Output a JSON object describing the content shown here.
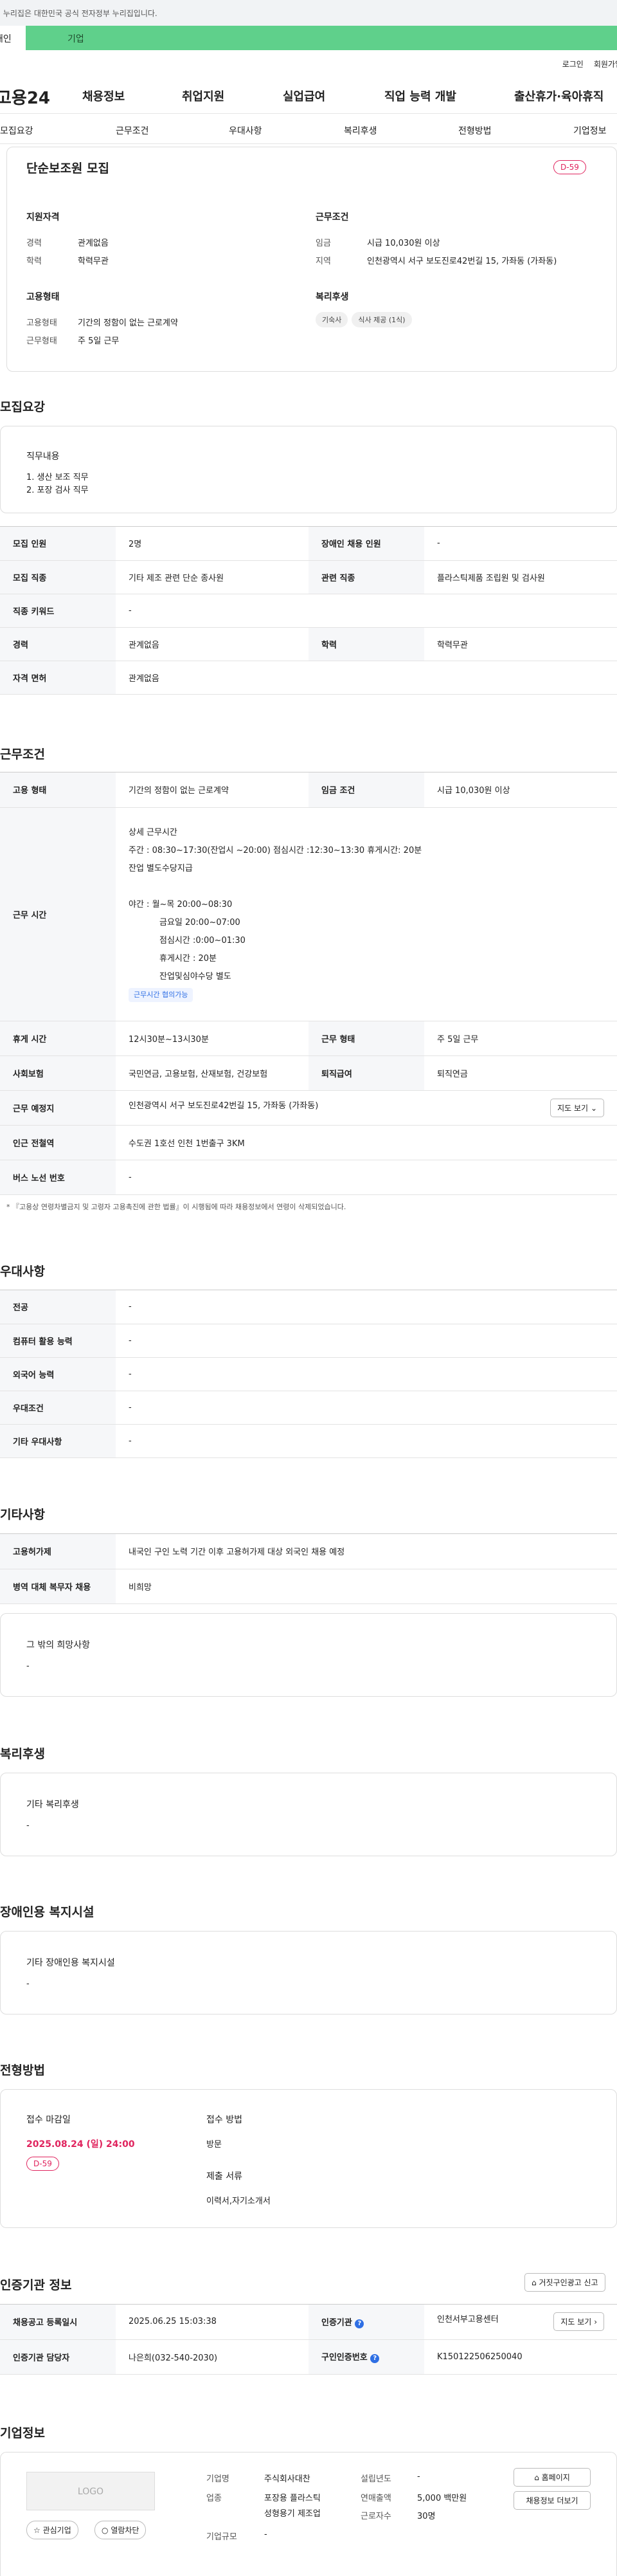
{
  "gov_banner": "이 누리집은 대한민국 공식 전자정부 누리집입니다.",
  "tabs": {
    "personal": "개인",
    "enterprise": "기업"
  },
  "util": {
    "login": "로그인",
    "signup": "회원가입"
  },
  "gnb": {
    "logo": "고용24",
    "menus": [
      "채용정보",
      "취업지원",
      "실업급여",
      "직업 능력 개발",
      "출산휴가·육아휴직"
    ]
  },
  "subnav": [
    "모집요강",
    "근무조건",
    "우대사항",
    "복리후생",
    "전형방법",
    "기업정보"
  ],
  "summary": {
    "title": "단순보조원 모집",
    "dday": "D-59",
    "qual_title": "지원자격",
    "qual": [
      {
        "k": "경력",
        "v": "관계없음"
      },
      {
        "k": "학력",
        "v": "학력무관"
      }
    ],
    "work_title": "근무조건",
    "work": [
      {
        "k": "임금",
        "v": "시급 10,030원 이상"
      },
      {
        "k": "지역",
        "v": "인천광역시 서구 보도진로42번길 15, 가좌동 (가좌동)"
      }
    ],
    "emp_title": "고용형태",
    "emp": [
      {
        "k": "고용형태",
        "v": "기간의 정함이 없는 근로계약"
      },
      {
        "k": "근무형태",
        "v": "주 5일 근무"
      }
    ],
    "welfare_title": "복리후생",
    "welfare_chips": [
      "기숙사",
      "식사 제공 (1식)"
    ]
  },
  "recruit": {
    "heading": "모집요강",
    "duty_title": "직무내용",
    "duties": [
      "1. 생산 보조 직무",
      "2. 포장 검사 직무"
    ],
    "rows": [
      {
        "k": "모집 인원",
        "v": "2명",
        "k2": "장애인 채용 인원",
        "v2": "-"
      },
      {
        "k": "모집 직종",
        "v": "기타 제조 관련 단순 종사원",
        "k2": "관련 직종",
        "v2": "플라스틱제품 조립원 및 검사원"
      },
      {
        "k": "직종 키워드",
        "v": "-"
      },
      {
        "k": "경력",
        "v": "관계없음",
        "k2": "학력",
        "v2": "학력무관"
      },
      {
        "k": "자격 면허",
        "v": "관계없음"
      }
    ]
  },
  "cond": {
    "heading": "근무조건",
    "emp_type_k": "고용 형태",
    "emp_type_v": "기간의 정함이 없는 근로계약",
    "wage_k": "임금 조건",
    "wage_v": "시급 10,030원 이상",
    "time_k": "근무 시간",
    "time_title": "상세 근무시간",
    "time_lines": [
      "주간 : 08:30~17:30(잔업시 ~20:00)  점심시간 :12:30~13:30 휴게시간: 20분",
      "잔업 별도수당지급",
      "",
      "야간 : 월~목 20:00~08:30",
      "          금요일 20:00~07:00",
      "          점심시간 :0:00~01:30",
      "          휴게시간 : 20분",
      "          잔업및심야수당 별도"
    ],
    "time_chip": "근무시간 협의가능",
    "rest_k": "휴게 시간",
    "rest_v": "12시30분~13시30분",
    "form_k": "근무 형태",
    "form_v": "주 5일 근무",
    "ins_k": "사회보험",
    "ins_v": "국민연금, 고용보험, 산재보험, 건강보험",
    "ret_k": "퇴직급여",
    "ret_v": "퇴직연금",
    "place_k": "근무 예정지",
    "place_v": "인천광역시 서구 보도진로42번길 15, 가좌동 (가좌동)",
    "map_btn": "지도 보기",
    "sub_k": "인근 전철역",
    "sub_v": "수도권 1호선 인천 1번출구 3KM",
    "bus_k": "버스 노선 번호",
    "bus_v": "-",
    "note": "* 『고용상 연령차별금지 및 고령자 고용촉진에 관한 법률』이 시행됨에 따라 채용정보에서 연령이 삭제되었습니다."
  },
  "pref": {
    "heading": "우대사항",
    "rows": [
      {
        "k": "전공",
        "v": "-"
      },
      {
        "k": "컴퓨터 활용 능력",
        "v": "-"
      },
      {
        "k": "외국어 능력",
        "v": "-"
      },
      {
        "k": "우대조건",
        "v": "-"
      },
      {
        "k": "기타 우대사항",
        "v": "-"
      }
    ]
  },
  "etc": {
    "heading": "기타사항",
    "rows": [
      {
        "k": "고용허가제",
        "v": "내국인 구인 노력 기간 이후 고용허가제 대상 외국인 채용 예정"
      },
      {
        "k": "병역 대체 복무자 채용",
        "v": "비희망"
      }
    ],
    "hope_title": "그 밖의 희망사항",
    "hope_v": "-"
  },
  "benefit": {
    "heading": "복리후생",
    "sub": "기타 복리후생",
    "v": "-"
  },
  "disab": {
    "heading": "장애인용 복지시설",
    "sub": "기타 장애인용 복지시설",
    "v": "-"
  },
  "process": {
    "heading": "전형방법",
    "deadline_k": "접수 마감일",
    "deadline_v": "2025.08.24 (일) 24:00",
    "dday": "D-59",
    "method_k": "접수 방법",
    "method_v": "방문",
    "docs_k": "제출 서류",
    "docs_v": "이력서,자기소개서"
  },
  "cert": {
    "heading": "인증기관 정보",
    "report_btn": "거짓구인광고 신고",
    "reg_k": "채용공고 등록일시",
    "reg_v": "2025.06.25 15:03:38",
    "org_k": "인증기관",
    "org_v": "인천서부고용센터",
    "map_btn": "지도 보기",
    "mgr_k": "인증기관 담당자",
    "mgr_v": "나은희(032-540-2030)",
    "no_k": "구인인증번호",
    "no_v": "K150122506250040"
  },
  "company": {
    "heading": "기업정보",
    "logo": "LOGO",
    "fav": "관심기업",
    "block": "열람차단",
    "name_k": "기업명",
    "name_v": "주식회사대찬",
    "year_k": "설립년도",
    "year_v": "-",
    "ind_k": "업종",
    "ind_v1": "포장용 플라스틱",
    "ind_v2": "성형용기 제조업",
    "sales_k": "연매출액",
    "sales_v": "5,000 백만원",
    "emp_k": "근로자수",
    "emp_v": "30명",
    "size_k": "기업규모",
    "size_v": "-",
    "home_btn": "홈페이지",
    "more_btn": "채용정보 더보기"
  }
}
